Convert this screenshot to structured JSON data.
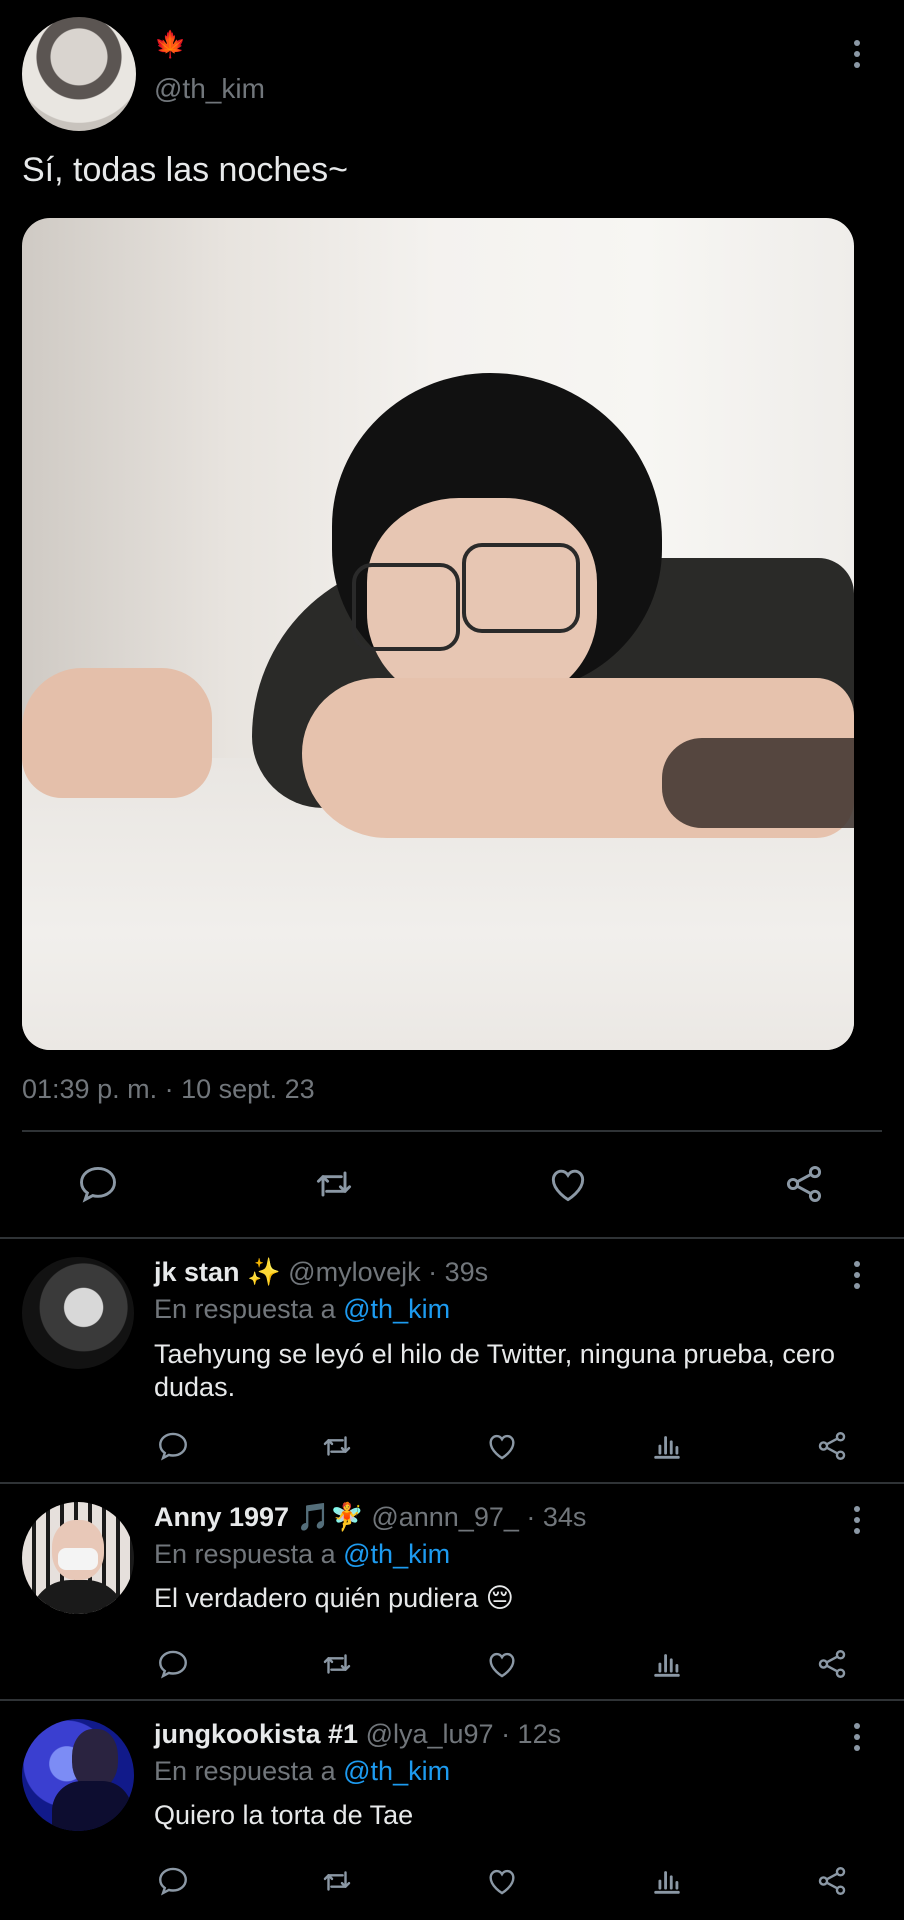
{
  "tweet": {
    "author_emoji": "🍁",
    "handle": "@th_kim",
    "text": "Sí, todas las noches~",
    "timestamp": "01:39 p. m. · 10 sept. 23"
  },
  "replies": [
    {
      "name": "jk stan ✨",
      "meta": "@mylovejk · 39s",
      "reply_prefix": "En respuesta a",
      "reply_to": "@th_kim",
      "text": "Taehyung se leyó el hilo de Twitter, ninguna prueba, cero dudas."
    },
    {
      "name": "Anny 1997 🎵🧚",
      "meta": "@annn_97_ · 34s",
      "reply_prefix": "En respuesta a",
      "reply_to": "@th_kim",
      "text": "El verdadero quién pudiera 😔"
    },
    {
      "name": "jungkookista #1",
      "meta": "@lya_lu97 · 12s",
      "reply_prefix": "En respuesta a",
      "reply_to": "@th_kim",
      "text": "Quiero la torta de Tae"
    }
  ],
  "icons": {
    "reply": "reply-icon",
    "retweet": "retweet-icon",
    "like": "heart-icon",
    "views": "views-icon",
    "share": "share-icon",
    "more": "more-icon"
  },
  "colors": {
    "background": "#000000",
    "text": "#e7e9ea",
    "muted": "#71767b",
    "link": "#1d9bf0",
    "divider": "#2f3336"
  }
}
